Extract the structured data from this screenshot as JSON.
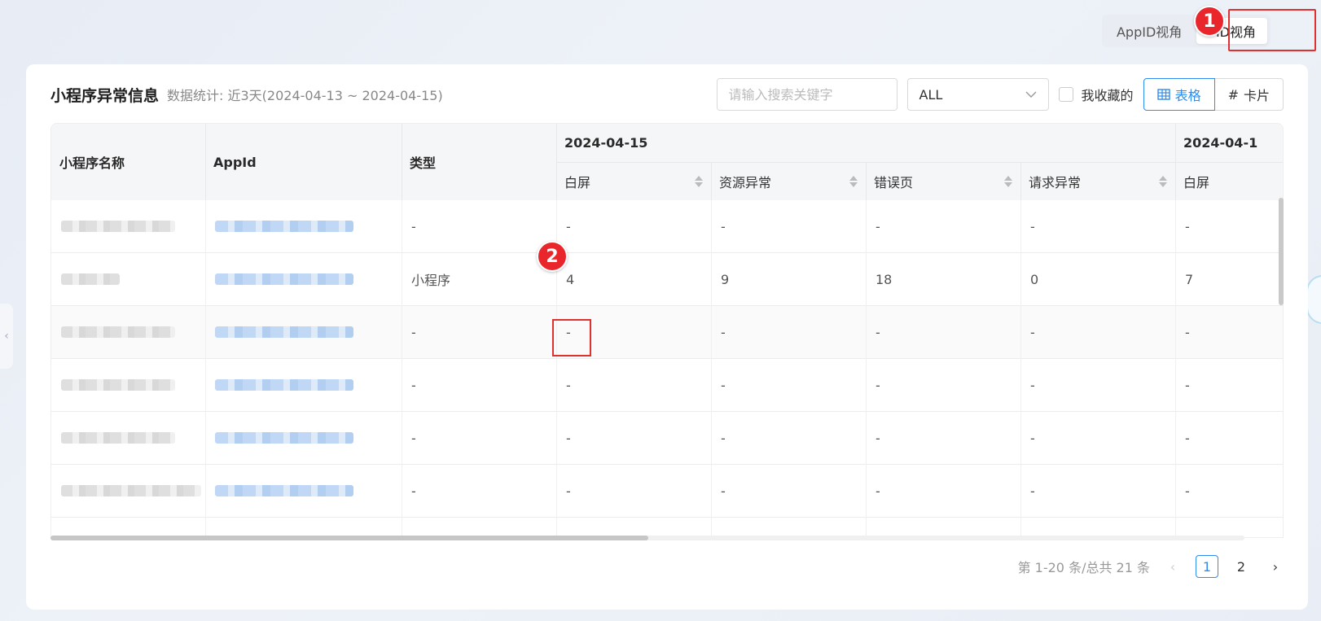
{
  "view_switch": {
    "appid_label": "AppID视角",
    "pid_label": "PID视角",
    "active": "PID视角"
  },
  "annotations": {
    "badge1": "1",
    "badge2": "2"
  },
  "header": {
    "title": "小程序异常信息",
    "subtitle": "数据统计: 近3天(2024-04-13 ~ 2024-04-15)"
  },
  "search": {
    "placeholder": "请输入搜索关键字",
    "value": ""
  },
  "filter": {
    "selected": "ALL"
  },
  "favorites": {
    "label": "我收藏的",
    "checked": false
  },
  "view_toggle": {
    "table_label": "表格",
    "card_label": "卡片",
    "active": "表格"
  },
  "table": {
    "col_name": "小程序名称",
    "col_appid": "AppId",
    "col_type": "类型",
    "group1_date": "2024-04-15",
    "group2_date": "2024-04-1",
    "sub_cols": [
      "白屏",
      "资源异常",
      "错误页",
      "请求异常",
      "白屏"
    ],
    "rows": [
      {
        "type": "-",
        "vals": [
          "-",
          "-",
          "-",
          "-",
          "-"
        ]
      },
      {
        "type": "小程序",
        "vals": [
          "4",
          "9",
          "18",
          "0",
          "7"
        ]
      },
      {
        "type": "-",
        "vals": [
          "-",
          "-",
          "-",
          "-",
          "-"
        ]
      },
      {
        "type": "-",
        "vals": [
          "-",
          "-",
          "-",
          "-",
          "-"
        ]
      },
      {
        "type": "-",
        "vals": [
          "-",
          "-",
          "-",
          "-",
          "-"
        ]
      },
      {
        "type": "-",
        "vals": [
          "-",
          "-",
          "-",
          "-",
          "-"
        ]
      }
    ]
  },
  "pagination": {
    "summary": "第 1-20 条/总共 21 条",
    "pages": [
      "1",
      "2"
    ],
    "current": "1"
  },
  "colors": {
    "accent": "#2f8cf0",
    "annotation_red": "#e8262b"
  }
}
